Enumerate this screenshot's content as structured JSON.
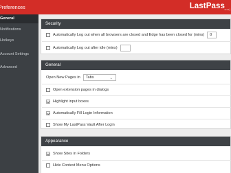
{
  "window": {
    "title": "Preferences"
  },
  "brand": {
    "logo": "LastPass",
    "dots": "••••|",
    "accent": "#d32d27"
  },
  "sidebar": {
    "items": [
      {
        "label": "General"
      },
      {
        "label": "Notifications"
      },
      {
        "label": "Hotkeys"
      },
      {
        "label": "Account Settings"
      },
      {
        "label": "Advanced"
      }
    ]
  },
  "security": {
    "header": "Security",
    "logout_closed_label": "Automatically Log out when all browsers are closed and Edge has been closed for (mins)",
    "logout_closed_value": "0",
    "logout_idle_label": "Automatically Log out after idle (mins)",
    "logout_idle_value": ""
  },
  "general": {
    "header": "General",
    "open_pages_label": "Open New Pages in",
    "open_pages_value": "Tabs",
    "open_ext_label": "Open extension pages in dialogs",
    "highlight_label": "Highlight input boxes",
    "autofill_label": "Automatically Fill Login Information",
    "show_vault_label": "Show My LastPass Vault After Login"
  },
  "appearance": {
    "header": "Appearance",
    "show_sites_label": "Show Sites in Folders",
    "hide_context_label": "Hide Context Menu Options"
  }
}
